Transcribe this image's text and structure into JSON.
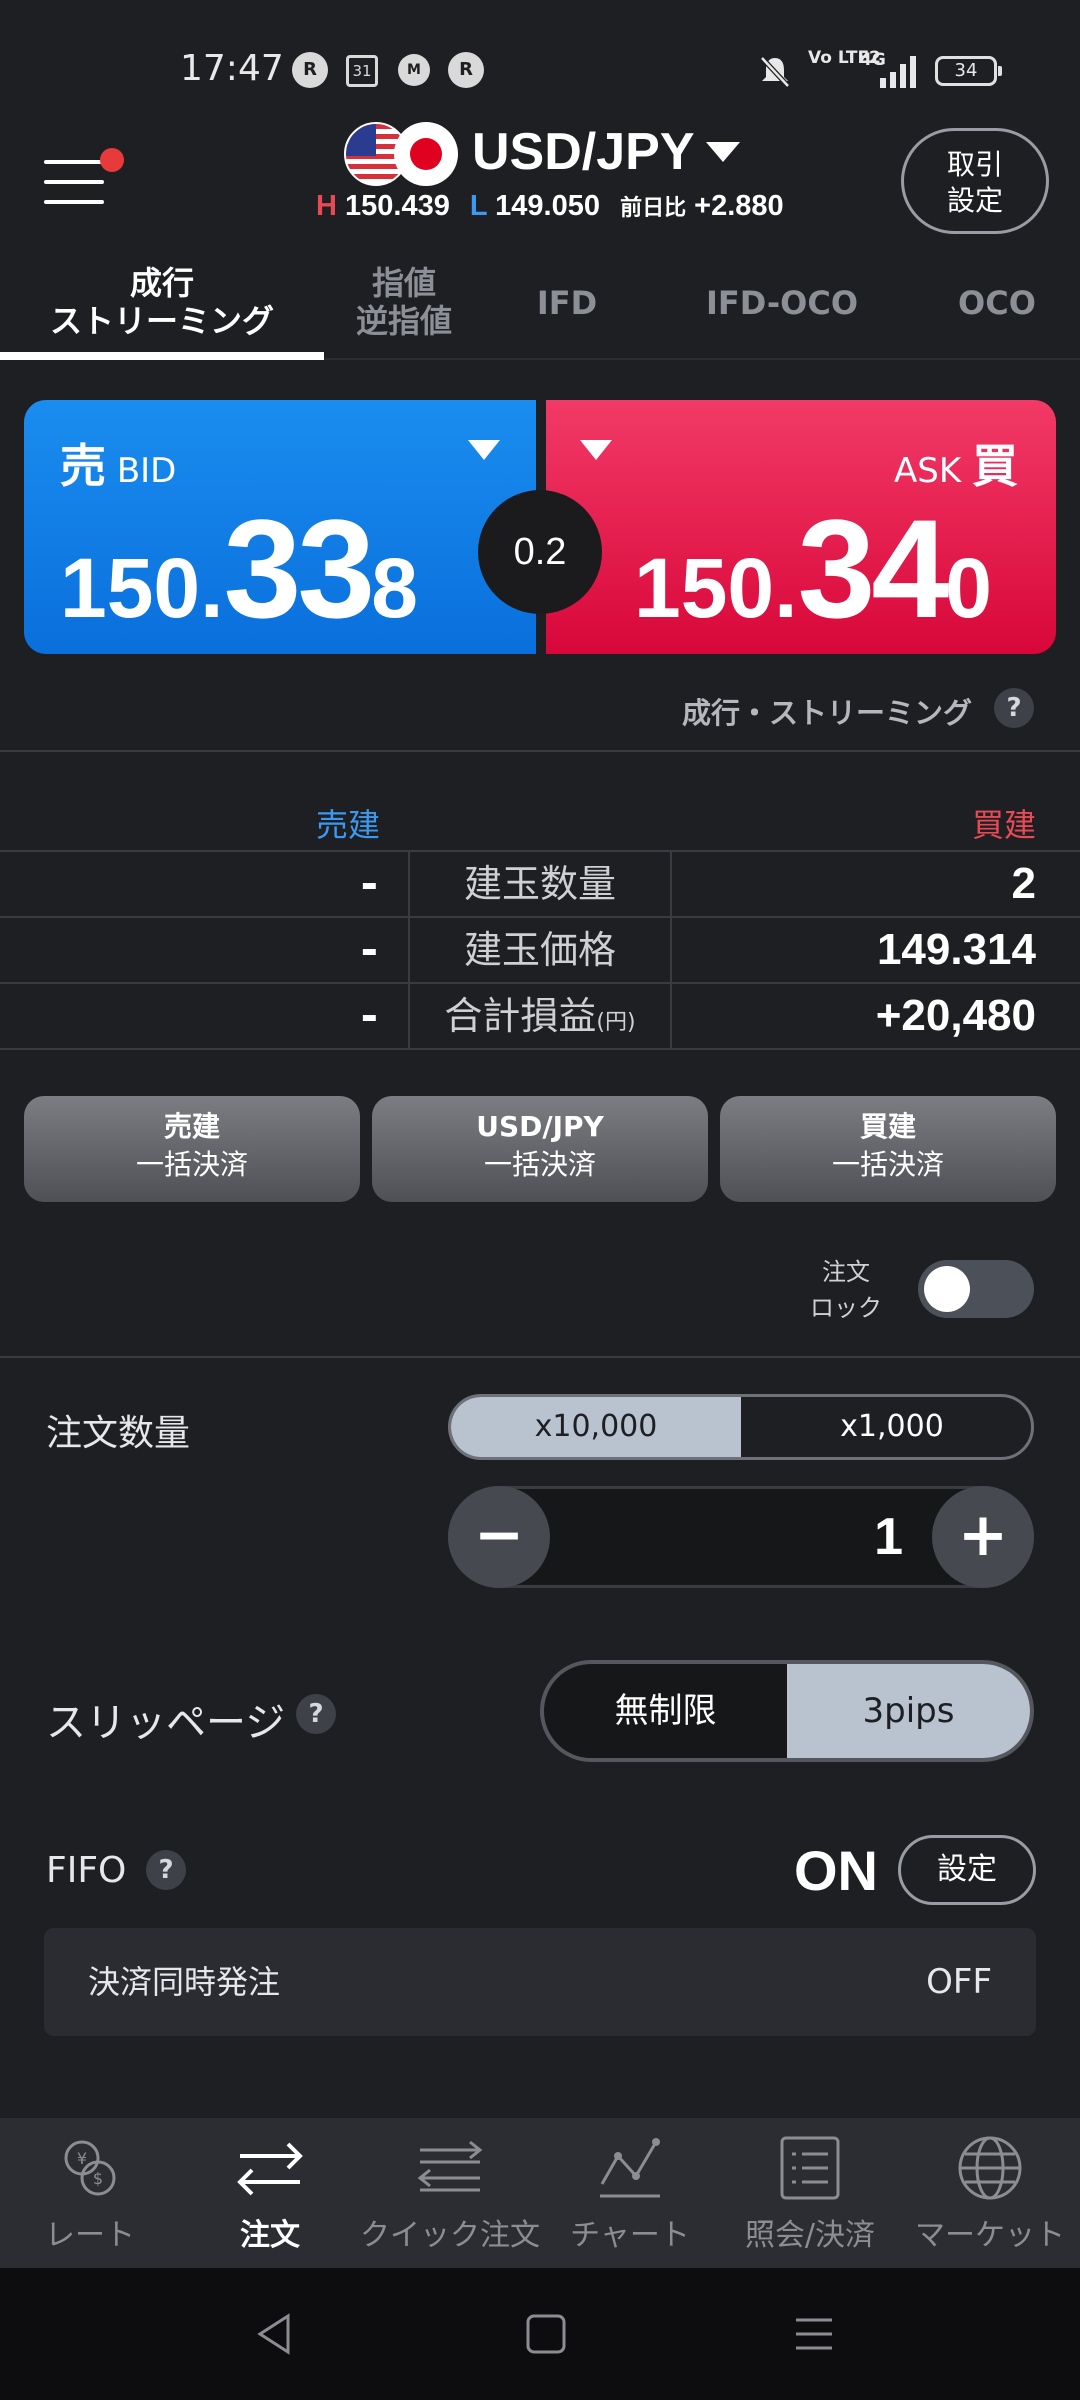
{
  "status_bar": {
    "time": "17:47",
    "icons": [
      "rakuten-link-icon",
      "calendar-icon",
      "messenger-icon",
      "rakuten-link-icon",
      "mute-icon",
      "volte-icon",
      "4g-signal-icon"
    ],
    "calendar_day": "31",
    "volte": "Vo LTE2",
    "network": "4G",
    "battery": "34"
  },
  "header": {
    "pair": "USD/JPY",
    "high_label": "H",
    "high": "150.439",
    "low_label": "L",
    "low": "149.050",
    "diff_label": "前日比",
    "diff": "+2.880",
    "trade_settings_line1": "取引",
    "trade_settings_line2": "設定"
  },
  "tabs": [
    {
      "line1": "成行",
      "line2": "ストリーミング",
      "active": true
    },
    {
      "line1": "指値",
      "line2": "逆指値",
      "active": false
    },
    {
      "line1": "IFD",
      "line2": "",
      "active": false
    },
    {
      "line1": "IFD-OCO",
      "line2": "",
      "active": false
    },
    {
      "line1": "OCO",
      "line2": "",
      "active": false
    }
  ],
  "prices": {
    "bid_kanji": "売",
    "bid_label": "BID",
    "bid_main": "150.",
    "bid_big": "33",
    "bid_last": "8",
    "ask_kanji": "買",
    "ask_label": "ASK",
    "ask_main": "150.",
    "ask_big": "34",
    "ask_last": "0",
    "spread": "0.2",
    "bid_color": "#0a7be6",
    "ask_color": "#e8144a"
  },
  "order_type_note": "成行・ストリーミング",
  "positions": {
    "sell_header": "売建",
    "buy_header": "買建",
    "sell_color": "#3b9af0",
    "buy_color": "#e84a55",
    "rows": [
      {
        "sell": "-",
        "label": "建玉数量",
        "unit": "",
        "buy": "2"
      },
      {
        "sell": "-",
        "label": "建玉価格",
        "unit": "",
        "buy": "149.314"
      },
      {
        "sell": "-",
        "label": "合計損益",
        "unit": "(円)",
        "buy": "+20,480"
      }
    ]
  },
  "bulk_buttons": [
    {
      "line1": "売建",
      "line2": "一括決済"
    },
    {
      "line1": "USD/JPY",
      "line2": "一括決済"
    },
    {
      "line1": "買建",
      "line2": "一括決済"
    }
  ],
  "order_lock": {
    "line1": "注文",
    "line2": "ロック",
    "on": false
  },
  "quantity": {
    "label": "注文数量",
    "unit_selected": "x10,000",
    "unit_other": "x1,000",
    "value": "1",
    "minus": "−",
    "plus": "+"
  },
  "slippage": {
    "label": "スリッページ",
    "option_unlimited": "無制限",
    "option_pips": "3pips",
    "selected": "3pips"
  },
  "fifo": {
    "label": "FIFO",
    "state": "ON",
    "settings": "設定"
  },
  "simultaneous": {
    "label": "決済同時発注",
    "value": "OFF"
  },
  "help_mark": "?",
  "bottom_nav": [
    {
      "label": "レート",
      "icon": "rate-icon",
      "active": false
    },
    {
      "label": "注文",
      "icon": "order-icon",
      "active": true
    },
    {
      "label": "クイック注文",
      "icon": "quick-order-icon",
      "active": false
    },
    {
      "label": "チャート",
      "icon": "chart-icon",
      "active": false
    },
    {
      "label": "照会/決済",
      "icon": "inquiry-icon",
      "active": false
    },
    {
      "label": "マーケット",
      "icon": "market-icon",
      "active": false
    }
  ]
}
